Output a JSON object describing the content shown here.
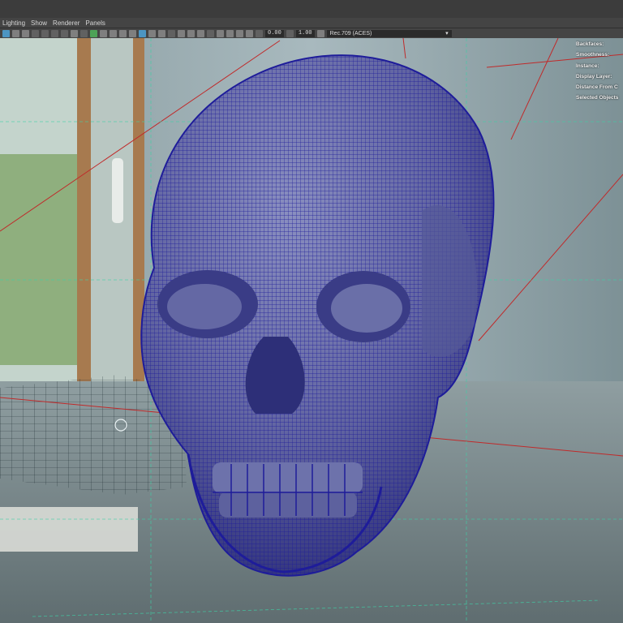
{
  "menu": [
    "Lighting",
    "Show",
    "Renderer",
    "Panels"
  ],
  "toolbar": {
    "value_a": "0.00",
    "value_b": "1.00",
    "color_space": "Rec.709 (ACES)",
    "dropdown_arrow": "▾"
  },
  "hud": [
    "Backfaces:",
    "Smoothness:",
    "Instance:",
    "Display Layer:",
    "Distance From C",
    "Selected Objects"
  ],
  "colors": {
    "wireframe": "#1e1c9a",
    "mesh_fill": "#6a6f9e",
    "camera_lines": "#c02a2a",
    "grid": "#3c8f74"
  },
  "icons": [
    "select-icon",
    "lasso-icon",
    "camera-icon",
    "gear-icon",
    "grid-icon",
    "shading-icon",
    "color-space-icon"
  ]
}
